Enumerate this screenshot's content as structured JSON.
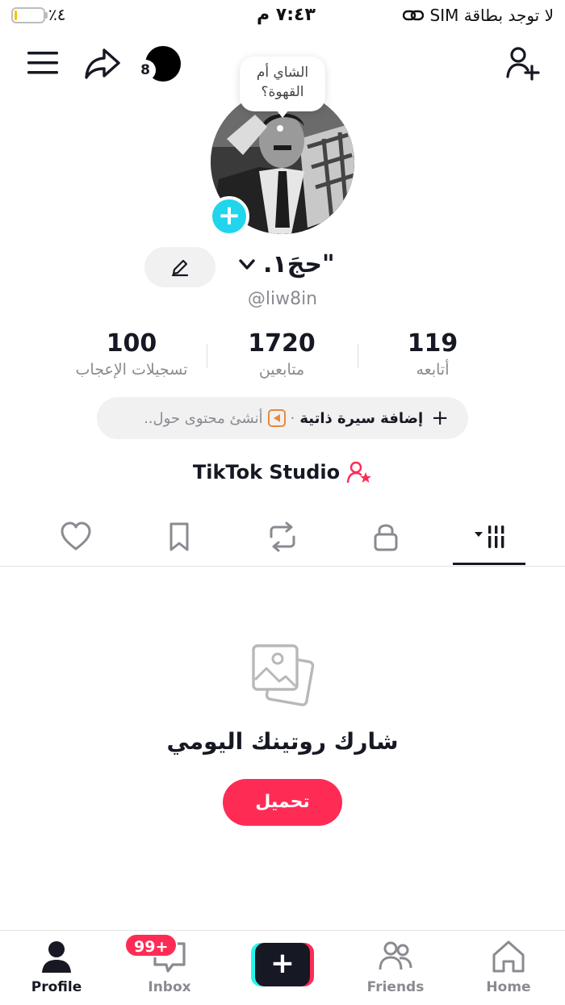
{
  "status_bar": {
    "battery_percent": "٤٪",
    "time": "٧:٤٣ م",
    "carrier": "لا توجد بطاقة SIM"
  },
  "top_bar": {
    "story_count": "8"
  },
  "profile": {
    "note": "الشاي أم القهوة؟",
    "display_name": "\"حجَ١.",
    "username": "@liw8in",
    "stats": [
      {
        "value": "119",
        "label": "أتابعه"
      },
      {
        "value": "1720",
        "label": "متابعين"
      },
      {
        "value": "100",
        "label": "تسجيلات الإعجاب"
      }
    ],
    "bio_add": "إضافة سيرة ذاتية",
    "bio_create": "أنشئ محتوى حول..",
    "studio": "TikTok Studio"
  },
  "tabs": [
    "videos",
    "private",
    "reposts",
    "favorites",
    "liked"
  ],
  "empty_state": {
    "title": "شارك روتينك اليومي",
    "button": "تحميل"
  },
  "bottom_nav": {
    "items": [
      {
        "label": "Profile",
        "icon": "person-icon"
      },
      {
        "label": "Inbox",
        "icon": "inbox-icon"
      },
      {
        "label": "Friends",
        "icon": "friends-icon"
      },
      {
        "label": "Home",
        "icon": "home-icon"
      }
    ],
    "inbox_badge": "99+"
  },
  "colors": {
    "accent": "#fe2c55",
    "cyan": "#25f4ee",
    "plus_badge": "#20d5ec"
  }
}
